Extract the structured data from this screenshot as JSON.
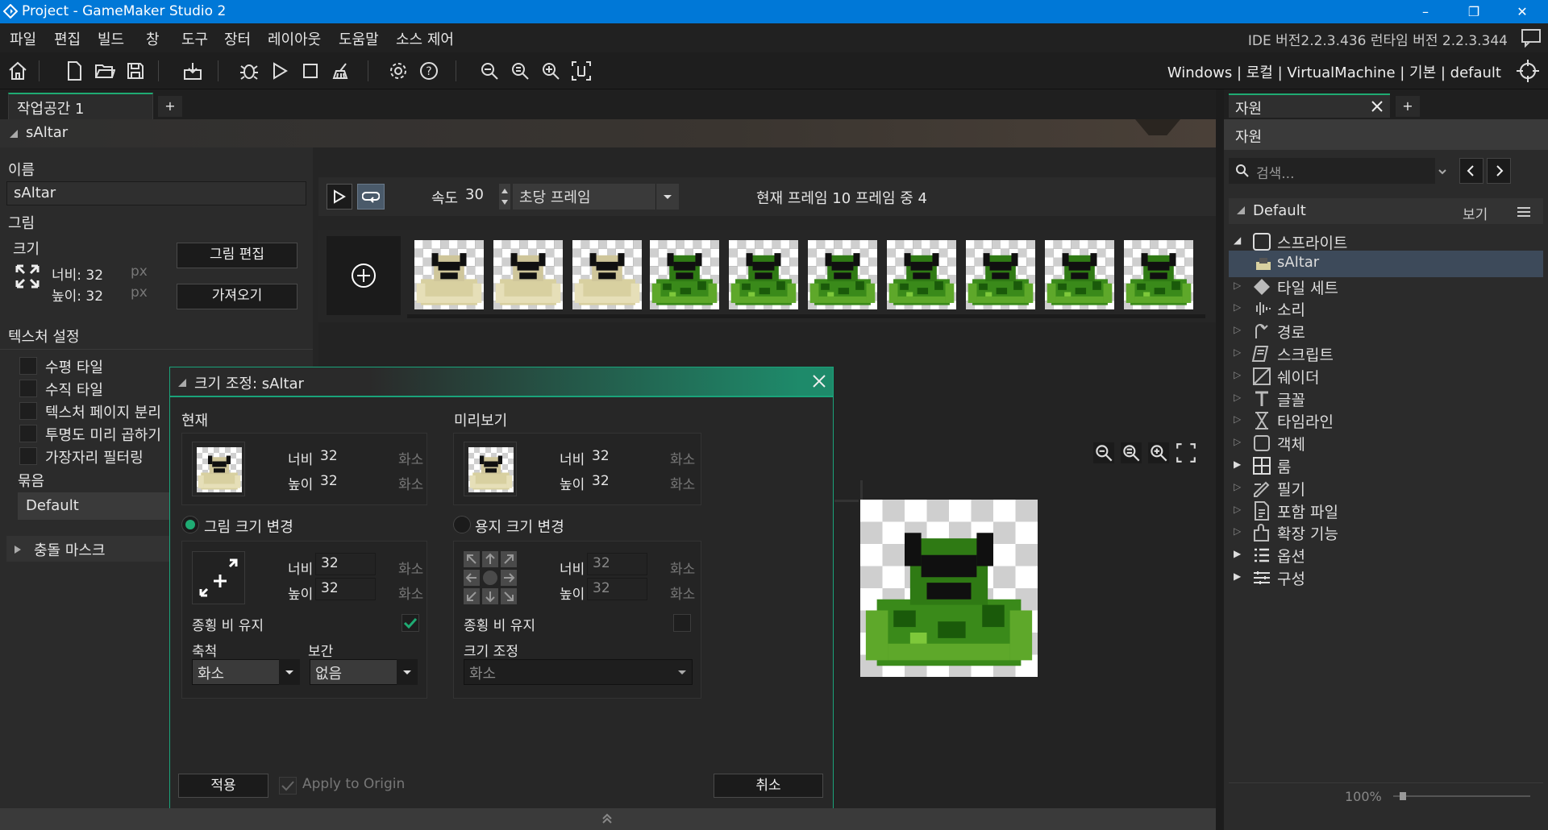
{
  "window": {
    "title": "Project - GameMaker Studio 2",
    "min": "–",
    "max": "❐",
    "close": "✕"
  },
  "menu": [
    "파일",
    "편집",
    "빌드",
    "창",
    "도구",
    "장터",
    "레이아웃",
    "도움말",
    "소스 제어"
  ],
  "version": "IDE 버전2.2.3.436 런타임 버전 2.2.3.344",
  "targets": "Windows | 로컬 | VirtualMachine | 기본 | default",
  "workspace": {
    "tab": "작업공간 1",
    "plus": "+"
  },
  "sprite": {
    "header": "sAltar",
    "name_label": "이름",
    "name_value": "sAltar",
    "image_label": "그림",
    "size_label": "크기",
    "width": "너비: 32",
    "height": "높이: 32",
    "unit": "px",
    "edit_image": "그림 편집",
    "import": "가져오기",
    "texture_settings": "텍스처 설정",
    "checks": [
      "수평 타일",
      "수직 타일",
      "텍스처 페이지 분리",
      "투명도 미리 곱하기",
      "가장자리 필터링"
    ],
    "group_label": "묶음",
    "group_value": "Default",
    "collision_mask": "충돌 마스크"
  },
  "anim": {
    "speed_label": "속도",
    "speed": "30",
    "speed_mode": "초당 프레임",
    "frame_info": "현재 프레임 10 프레임 중 4",
    "add_frame": "+",
    "frame_count": 10
  },
  "dialog": {
    "title": "크기 조정: sAltar",
    "current": "현재",
    "preview": "미리보기",
    "width": "너비",
    "height": "높이",
    "unit": "화소",
    "cur_w": "32",
    "cur_h": "32",
    "prev_w": "32",
    "prev_h": "32",
    "resize_image": "그림 크기 변경",
    "resize_canvas": "용지 크기 변경",
    "img_w": "32",
    "img_h": "32",
    "can_w": "32",
    "can_h": "32",
    "keep_aspect": "종횡 비 유지",
    "scale_label": "축척",
    "scale_value": "화소",
    "interp_label": "보간",
    "interp_value": "없음",
    "canvas_size": "크기 조정",
    "canvas_unit": "화소",
    "apply": "적용",
    "apply_origin": "Apply to Origin",
    "cancel": "취소"
  },
  "resources": {
    "tab": "자원",
    "header": "자원",
    "search_placeholder": "검색...",
    "default": "Default",
    "view": "보기",
    "items": [
      {
        "label": "스프라이트",
        "icon": "sprite-icon",
        "open": true
      },
      {
        "label": "sAltar",
        "icon": "sprite-thumb-icon",
        "child": true
      },
      {
        "label": "타일 세트",
        "icon": "tileset-icon"
      },
      {
        "label": "소리",
        "icon": "sound-icon"
      },
      {
        "label": "경로",
        "icon": "path-icon"
      },
      {
        "label": "스크립트",
        "icon": "script-icon"
      },
      {
        "label": "쉐이더",
        "icon": "shader-icon"
      },
      {
        "label": "글꼴",
        "icon": "font-icon"
      },
      {
        "label": "타임라인",
        "icon": "timeline-icon"
      },
      {
        "label": "객체",
        "icon": "object-icon"
      },
      {
        "label": "룸",
        "icon": "room-icon"
      },
      {
        "label": "필기",
        "icon": "notes-icon"
      },
      {
        "label": "포함 파일",
        "icon": "included-file-icon"
      },
      {
        "label": "확장 기능",
        "icon": "extension-icon"
      },
      {
        "label": "옵션",
        "icon": "options-icon"
      },
      {
        "label": "구성",
        "icon": "config-icon"
      }
    ],
    "zoom": "100%"
  },
  "colors": {
    "accent": "#1fab73",
    "titlebar": "#0078d7",
    "selected": "#3d4a5a"
  }
}
